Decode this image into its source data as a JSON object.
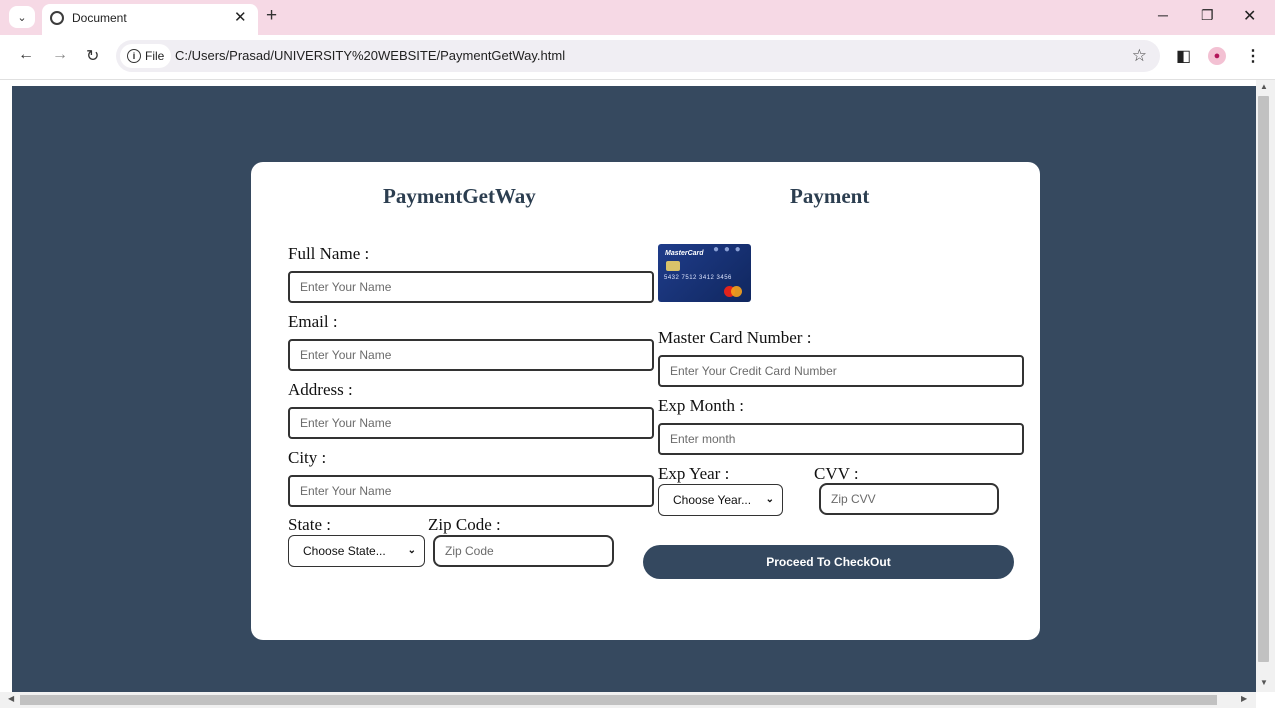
{
  "browser": {
    "tab_title": "Document",
    "tab_close": "✕",
    "new_tab": "+",
    "file_chip": "File",
    "url": "C:/Users/Prasad/UNIVERSITY%20WEBSITE/PaymentGetWay.html"
  },
  "card": {
    "left_heading": "PaymentGetWay",
    "right_heading": "Payment"
  },
  "billing": {
    "full_name_label": "Full Name :",
    "full_name_placeholder": "Enter Your Name",
    "email_label": "Email :",
    "email_placeholder": "Enter Your Name",
    "address_label": "Address :",
    "address_placeholder": "Enter Your Name",
    "city_label": "City :",
    "city_placeholder": "Enter Your Name",
    "state_label": "State :",
    "state_value": "Choose State...",
    "zip_label": "Zip Code :",
    "zip_placeholder": "Zip Code"
  },
  "payment": {
    "card_brand": "MasterCard",
    "card_number_graphic": "5432 7512 3412 3456",
    "card_number_label": "Master Card Number :",
    "card_number_placeholder": "Enter Your Credit Card Number",
    "exp_month_label": "Exp Month :",
    "exp_month_placeholder": "Enter month",
    "exp_year_label": "Exp Year :",
    "exp_year_value": "Choose Year...",
    "cvv_label": "CVV :",
    "cvv_placeholder": "Zip CVV",
    "checkout_label": "Proceed To CheckOut"
  },
  "icons": [
    "tab-menu-icon",
    "globe-icon",
    "close-icon",
    "plus-icon",
    "minimize-icon",
    "restore-icon",
    "window-close-icon",
    "back-arrow-icon",
    "forward-arrow-icon",
    "reload-icon",
    "info-icon",
    "star-icon",
    "side-panel-icon",
    "profile-icon",
    "more-vert-icon",
    "chevron-down-icon"
  ],
  "colors": {
    "page_bg": "#36495f",
    "button_bg": "#34485f",
    "tabbar_bg": "#f6d9e5"
  }
}
